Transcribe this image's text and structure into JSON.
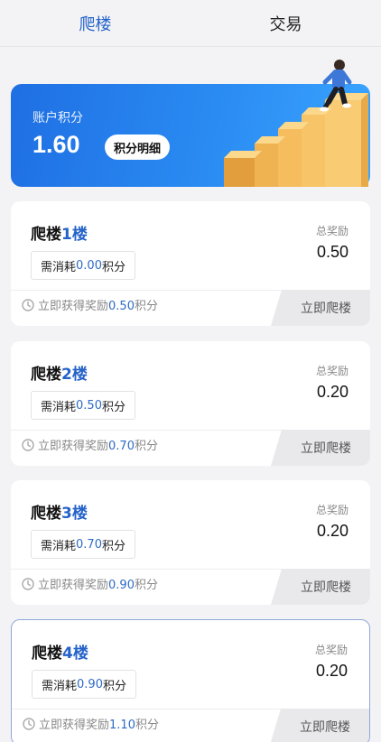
{
  "tabs": [
    {
      "label": "爬楼",
      "active": true
    },
    {
      "label": "交易",
      "active": false
    }
  ],
  "banner": {
    "label": "账户积分",
    "value": "1.60",
    "detail_button": "积分明细"
  },
  "cards": [
    {
      "title_prefix": "爬楼",
      "title_num": "1楼",
      "cost_prefix": "需消耗",
      "cost": "0.00",
      "cost_suffix": "积分",
      "reward_label": "总奖励",
      "reward_value": "0.50",
      "foot_prefix": "立即获得奖励",
      "foot_amount": "0.50",
      "foot_suffix": "积分",
      "button": "立即爬楼"
    },
    {
      "title_prefix": "爬楼",
      "title_num": "2楼",
      "cost_prefix": "需消耗",
      "cost": "0.50",
      "cost_suffix": "积分",
      "reward_label": "总奖励",
      "reward_value": "0.20",
      "foot_prefix": "立即获得奖励",
      "foot_amount": "0.70",
      "foot_suffix": "积分",
      "button": "立即爬楼"
    },
    {
      "title_prefix": "爬楼",
      "title_num": "3楼",
      "cost_prefix": "需消耗",
      "cost": "0.70",
      "cost_suffix": "积分",
      "reward_label": "总奖励",
      "reward_value": "0.20",
      "foot_prefix": "立即获得奖励",
      "foot_amount": "0.90",
      "foot_suffix": "积分",
      "button": "立即爬楼"
    },
    {
      "title_prefix": "爬楼",
      "title_num": "4楼",
      "cost_prefix": "需消耗",
      "cost": "0.90",
      "cost_suffix": "积分",
      "reward_label": "总奖励",
      "reward_value": "0.20",
      "foot_prefix": "立即获得奖励",
      "foot_amount": "1.10",
      "foot_suffix": "积分",
      "button": "立即爬楼"
    }
  ],
  "colors": {
    "accent": "#2563c9",
    "banner_start": "#1f6fe3",
    "banner_end": "#3aa4ff",
    "page_bg": "#f3f3f5"
  },
  "icons": {
    "banner_illustration": "stairs-climber-illustration",
    "foot": "clock-icon"
  }
}
